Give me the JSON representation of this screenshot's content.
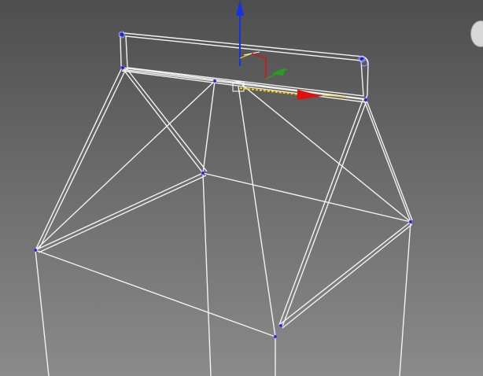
{
  "viewport": {
    "label": "",
    "colors": {
      "wire": "#f2f2f2",
      "vertex": "#2222cc",
      "axis_x": "#e01010",
      "axis_y": "#21a021",
      "axis_z": "#1432e6",
      "constraint": "#ffd400"
    }
  },
  "gizmo": {
    "x_axis_label": "",
    "y_axis_label": "",
    "z_axis_label": ""
  },
  "icons": [
    "move-gizmo-icon",
    "view-cube-icon",
    "pivot-box-icon"
  ]
}
